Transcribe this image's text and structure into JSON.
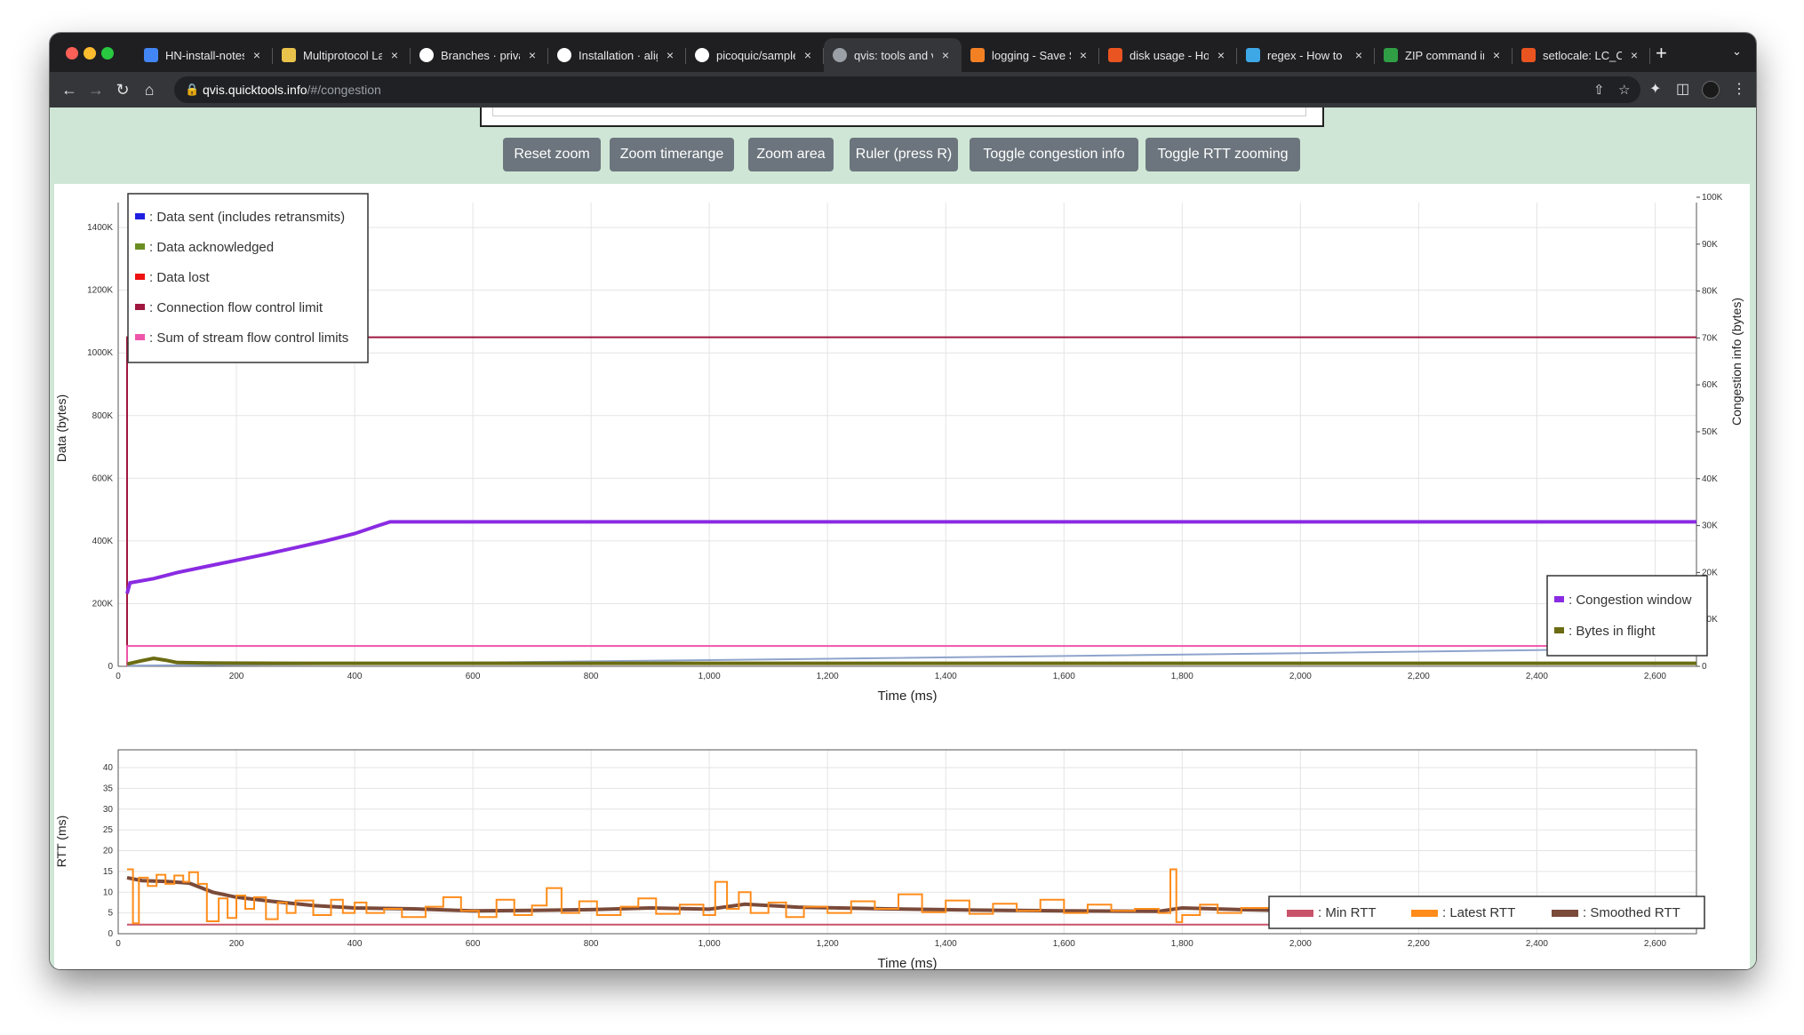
{
  "browser": {
    "tabs": [
      {
        "title": "HN-install-notes",
        "favicon": "docs-icon",
        "color": "#4285f4"
      },
      {
        "title": "Multiprotocol Label",
        "favicon": "multiprotocol-icon",
        "color": "#e8c24a"
      },
      {
        "title": "Branches · private",
        "favicon": "github-icon",
        "color": "#ffffff"
      },
      {
        "title": "Installation · align",
        "favicon": "github-icon",
        "color": "#ffffff"
      },
      {
        "title": "picoquic/sample",
        "favicon": "github-icon",
        "color": "#ffffff"
      },
      {
        "title": "qvis: tools and visualizations",
        "favicon": "globe-icon",
        "color": "#9aa0a6",
        "active": true
      },
      {
        "title": "logging - Save Stack",
        "favicon": "stackoverflow-icon",
        "color": "#f48024"
      },
      {
        "title": "disk usage - How",
        "favicon": "askubuntu-icon",
        "color": "#e95420"
      },
      {
        "title": "regex - How to",
        "favicon": "regex-icon",
        "color": "#3ea8e6"
      },
      {
        "title": "ZIP command in",
        "favicon": "zip-icon",
        "color": "#2f9e44"
      },
      {
        "title": "setlocale: LC_CTYPE",
        "favicon": "askubuntu-icon",
        "color": "#e95420"
      }
    ],
    "url_host": "qvis.quicktools.info",
    "url_path": "/#/congestion"
  },
  "controls": {
    "buttons": [
      "Reset zoom",
      "Zoom timerange",
      "Zoom area",
      "Ruler (press R)",
      "Toggle congestion info",
      "Toggle RTT zooming"
    ]
  },
  "chart_data": [
    {
      "type": "line",
      "xlabel": "Time (ms)",
      "ylabel": "Data (bytes)",
      "ylabel_right": "Congestion info (bytes)",
      "xlim": [
        0,
        2670
      ],
      "ylim": [
        0,
        1440000
      ],
      "ylim_right": [
        0,
        100000
      ],
      "x_ticks": [
        0,
        200,
        400,
        600,
        800,
        1000,
        1200,
        1400,
        1600,
        1800,
        2000,
        2200,
        2400,
        2600
      ],
      "x_tick_labels": [
        "0",
        "200",
        "400",
        "600",
        "800",
        "1,000",
        "1,200",
        "1,400",
        "1,600",
        "1,800",
        "2,000",
        "2,200",
        "2,400",
        "2,600"
      ],
      "y_ticks": [
        0,
        200000,
        400000,
        600000,
        800000,
        1000000,
        1200000,
        1400000
      ],
      "y_tick_labels": [
        "0",
        "200K",
        "400K",
        "600K",
        "800K",
        "1000K",
        "1200K",
        "1400K"
      ],
      "y_right_ticks": [
        0,
        10000,
        20000,
        30000,
        40000,
        50000,
        60000,
        70000,
        80000,
        90000,
        100000
      ],
      "y_right_tick_labels": [
        "0",
        "10K",
        "20K",
        "30K",
        "40K",
        "50K",
        "60K",
        "70K",
        "80K",
        "90K",
        "100K"
      ],
      "grid": true,
      "legend_left": [
        {
          "name": "Data sent (includes retransmits)",
          "color": "#1f1fe0"
        },
        {
          "name": "Data acknowledged",
          "color": "#6b8e23"
        },
        {
          "name": "Data lost",
          "color": "#ee1111"
        },
        {
          "name": "Connection flow control limit",
          "color": "#a0173f"
        },
        {
          "name": "Sum of stream flow control limits",
          "color": "#ee55aa"
        }
      ],
      "legend_right": [
        {
          "name": "Congestion window",
          "color": "#8a2be2"
        },
        {
          "name": "Bytes in flight",
          "color": "#6b6b12"
        }
      ],
      "series": [
        {
          "name": "Connection flow control limit",
          "axis": "left",
          "color": "#a0173f",
          "x": [
            15,
            15,
            2670
          ],
          "y": [
            0,
            1050000,
            1050000
          ]
        },
        {
          "name": "Sum of stream flow control limits",
          "axis": "left",
          "color": "#ee55aa",
          "x": [
            15,
            15,
            2670
          ],
          "y": [
            0,
            65000,
            65000
          ]
        },
        {
          "name": "Data sent (includes retransmits)",
          "axis": "left",
          "color": "#8fa4cc",
          "x": [
            15,
            400,
            800,
            1200,
            1600,
            2000,
            2400,
            2670
          ],
          "y": [
            2000,
            8000,
            16000,
            24000,
            33000,
            42000,
            52000,
            60000
          ]
        },
        {
          "name": "Congestion window",
          "axis": "right",
          "color": "#8a2be2",
          "x": [
            15,
            20,
            60,
            100,
            150,
            200,
            250,
            300,
            350,
            400,
            440,
            460,
            2670
          ],
          "y": [
            15500,
            17800,
            18700,
            20000,
            21300,
            22600,
            23900,
            25300,
            26700,
            28300,
            30000,
            30800,
            30800
          ]
        },
        {
          "name": "Bytes in flight",
          "axis": "right",
          "color": "#6b6b12",
          "x": [
            15,
            40,
            60,
            80,
            100,
            150,
            300,
            600,
            1000,
            1400,
            1800,
            2200,
            2670
          ],
          "y": [
            500,
            1200,
            1700,
            1300,
            800,
            700,
            650,
            650,
            650,
            650,
            650,
            650,
            650
          ]
        }
      ]
    },
    {
      "type": "line",
      "xlabel": "Time (ms)",
      "ylabel": "RTT (ms)",
      "xlim": [
        0,
        2670
      ],
      "ylim": [
        0,
        40
      ],
      "x_ticks": [
        0,
        200,
        400,
        600,
        800,
        1000,
        1200,
        1400,
        1600,
        1800,
        2000,
        2200,
        2400,
        2600
      ],
      "x_tick_labels": [
        "0",
        "200",
        "400",
        "600",
        "800",
        "1,000",
        "1,200",
        "1,400",
        "1,600",
        "1,800",
        "2,000",
        "2,200",
        "2,400",
        "2,600"
      ],
      "y_ticks": [
        0,
        5,
        10,
        15,
        20,
        25,
        30,
        35,
        40
      ],
      "y_tick_labels": [
        "0",
        "5",
        "10",
        "15",
        "20",
        "25",
        "30",
        "35",
        "40"
      ],
      "grid": true,
      "legend": [
        {
          "name": "Min RTT",
          "color": "#c9536b"
        },
        {
          "name": "Latest RTT",
          "color": "#ff8c1a"
        },
        {
          "name": "Smoothed RTT",
          "color": "#7a4a3a"
        }
      ],
      "series": [
        {
          "name": "Min RTT",
          "color": "#c9536b",
          "x": [
            15,
            2670
          ],
          "y": [
            2.2,
            2.2
          ]
        },
        {
          "name": "Smoothed RTT",
          "color": "#7a4a3a",
          "x": [
            15,
            40,
            80,
            120,
            160,
            200,
            260,
            330,
            400,
            500,
            600,
            700,
            800,
            900,
            1000,
            1060,
            1150,
            1300,
            1450,
            1600,
            1760,
            1800,
            1900,
            2000,
            2670
          ],
          "y": [
            13.5,
            12.8,
            12.6,
            12.2,
            10.0,
            8.8,
            7.8,
            6.8,
            6.2,
            6.0,
            5.5,
            5.6,
            5.8,
            6.2,
            5.9,
            7.1,
            6.4,
            6.0,
            5.7,
            5.5,
            5.4,
            6.2,
            5.8,
            5.5,
            5.5
          ]
        },
        {
          "name": "Latest RTT",
          "color": "#ff8c1a",
          "x": [
            15,
            25,
            35,
            50,
            65,
            80,
            95,
            110,
            120,
            135,
            150,
            170,
            185,
            200,
            215,
            230,
            250,
            270,
            285,
            300,
            330,
            360,
            380,
            400,
            420,
            450,
            480,
            520,
            550,
            580,
            610,
            640,
            670,
            700,
            725,
            750,
            780,
            810,
            850,
            880,
            910,
            950,
            990,
            1010,
            1030,
            1050,
            1070,
            1100,
            1130,
            1160,
            1200,
            1240,
            1280,
            1320,
            1360,
            1400,
            1440,
            1480,
            1520,
            1560,
            1600,
            1640,
            1680,
            1720,
            1760,
            1780,
            1790,
            1800,
            1830,
            1860,
            1900,
            1950,
            2000
          ],
          "y": [
            15.5,
            2.5,
            13.5,
            11.5,
            14.2,
            12.0,
            14.0,
            12.5,
            14.8,
            12.0,
            3.0,
            8.5,
            3.8,
            9.2,
            6.0,
            8.8,
            3.5,
            7.5,
            5.0,
            8.0,
            4.5,
            8.2,
            5.0,
            7.5,
            5.0,
            6.0,
            4.0,
            6.5,
            8.8,
            5.5,
            4.0,
            8.2,
            4.5,
            6.8,
            11.0,
            5.0,
            7.8,
            4.5,
            6.5,
            8.5,
            4.8,
            7.0,
            4.5,
            12.5,
            6.0,
            10.0,
            5.0,
            7.5,
            4.0,
            6.5,
            5.0,
            7.8,
            6.0,
            9.5,
            5.2,
            8.0,
            4.8,
            7.2,
            5.5,
            8.2,
            5.0,
            7.0,
            5.5,
            6.0,
            5.0,
            15.5,
            2.8,
            4.5,
            7.0,
            5.0,
            6.2,
            3.0,
            5.5
          ]
        }
      ]
    }
  ]
}
